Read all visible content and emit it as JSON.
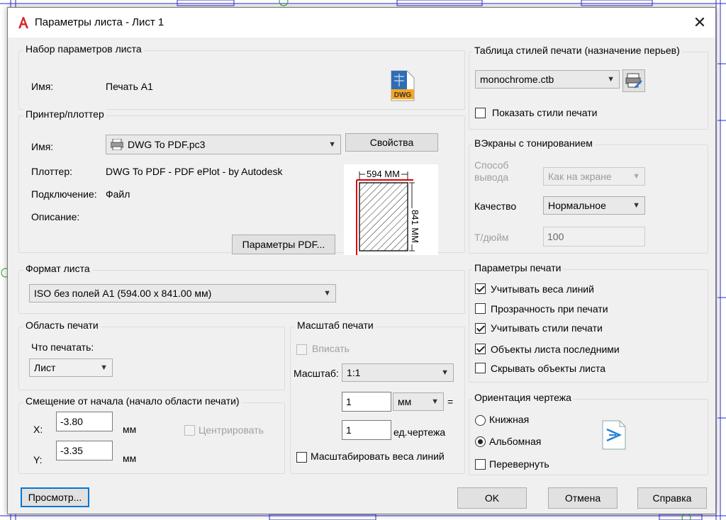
{
  "dialog": {
    "title": "Параметры листа - Лист 1"
  },
  "page_setup": {
    "title": "Набор параметров листа",
    "name_label": "Имя:",
    "name_value": "Печать А1"
  },
  "printer": {
    "title": "Принтер/плоттер",
    "name_label": "Имя:",
    "name_value": "DWG To PDF.pc3",
    "properties_button": "Свойства",
    "plotter_label": "Плоттер:",
    "plotter_value": "DWG To PDF - PDF ePlot - by Autodesk",
    "where_label": "Подключение:",
    "where_value": "Файл",
    "description_label": "Описание:",
    "pdf_options_button": "Параметры PDF...",
    "preview_width": "594 ММ",
    "preview_height": "841 ММ"
  },
  "paper_size": {
    "title": "Формат листа",
    "value": "ISO без полей A1 (594.00 x 841.00 мм)"
  },
  "plot_area": {
    "title": "Область печати",
    "what_label": "Что печатать:",
    "what_value": "Лист"
  },
  "plot_offset": {
    "title": "Смещение от начала (начало области печати)",
    "x_label": "X:",
    "x_value": "-3.80",
    "x_unit": "мм",
    "y_label": "Y:",
    "y_value": "-3.35",
    "y_unit": "мм",
    "center_label": "Центрировать"
  },
  "plot_scale": {
    "title": "Масштаб печати",
    "fit_label": "Вписать",
    "scale_label": "Масштаб:",
    "scale_value": "1:1",
    "value1": "1",
    "unit_value": "мм",
    "equals": "=",
    "value2": "1",
    "unit2_label": "ед.чертежа",
    "scale_lineweights_label": "Масштабировать веса линий"
  },
  "plot_style": {
    "title": "Таблица стилей печати (назначение перьев)",
    "value": "monochrome.ctb",
    "display_label": "Показать стили печати"
  },
  "shaded": {
    "title": "ВЭкраны с тонированием",
    "shade_label": "Способ вывода",
    "shade_value": "Как на экране",
    "quality_label": "Качество",
    "quality_value": "Нормальное",
    "dpi_label": "Т/дюйм",
    "dpi_value": "100"
  },
  "plot_options": {
    "title": "Параметры печати",
    "items": [
      {
        "label": "Учитывать веса линий",
        "checked": true
      },
      {
        "label": "Прозрачность при печати",
        "checked": false
      },
      {
        "label": "Учитывать стили печати",
        "checked": true
      },
      {
        "label": "Объекты листа последними",
        "checked": true
      },
      {
        "label": "Скрывать объекты листа",
        "checked": false
      }
    ]
  },
  "orientation": {
    "title": "Ориентация чертежа",
    "portrait": "Книжная",
    "landscape": "Альбомная",
    "upside_down": "Перевернуть",
    "selected": "landscape"
  },
  "footer": {
    "preview_button": "Просмотр...",
    "ok_button": "OK",
    "cancel_button": "Отмена",
    "help_button": "Справка"
  },
  "colors": {
    "accent": "#0078d7",
    "preview_red": "#e00000",
    "dwg_orange": "#f5a623"
  }
}
